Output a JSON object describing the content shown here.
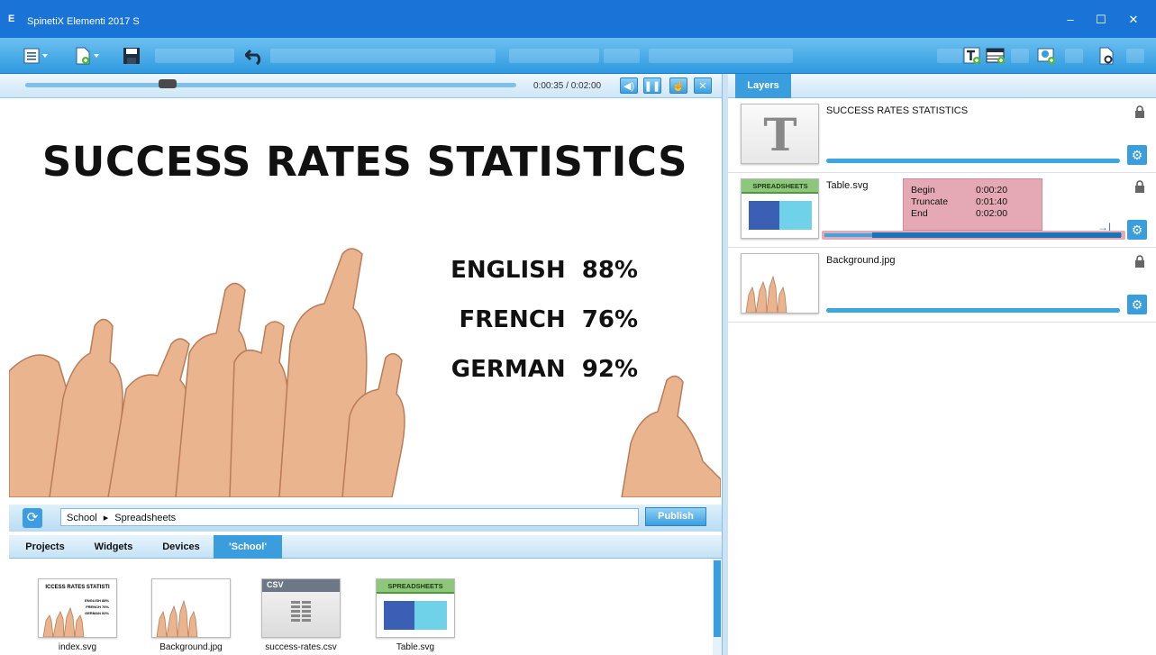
{
  "window": {
    "app_icon": "E",
    "title": "SpinetiX Elementi 2017 S",
    "minimize": "–",
    "maximize": "☐",
    "close": "✕"
  },
  "player": {
    "timecode": "0:00:35 / 0:02:00",
    "progress": 0.29
  },
  "preview": {
    "title": "SUCCESS RATES STATISTICS",
    "stats": [
      {
        "label": "ENGLISH  88%"
      },
      {
        "label": "FRENCH  76%"
      },
      {
        "label": "GERMAN  92%"
      }
    ]
  },
  "path": {
    "crumb1": "School",
    "sep": "▸",
    "crumb2": "Spreadsheets",
    "publish_label": "Publish"
  },
  "tabs": [
    {
      "label": "Projects"
    },
    {
      "label": "Widgets"
    },
    {
      "label": "Devices"
    },
    {
      "label": "'School'"
    }
  ],
  "files": [
    {
      "name": "index.svg",
      "thumb_text": "ICCESS RATES STATISTI",
      "stats_lines": [
        "ENGLISH 88%",
        "FRENCH 76%",
        "GERMAN 92%"
      ]
    },
    {
      "name": "Background.jpg"
    },
    {
      "name": "success-rates.csv",
      "badge": "CSV"
    },
    {
      "name": "Table.svg",
      "badge": "SPREADSHEETS"
    }
  ],
  "layers": {
    "tab_label": "Layers",
    "items": [
      {
        "name": "SUCCESS RATES STATISTICS",
        "thumb_letter": "T"
      },
      {
        "name": "Table.svg",
        "badge": "SPREADSHEETS"
      },
      {
        "name": "Background.jpg"
      }
    ],
    "timing": {
      "begin_label": "Begin",
      "begin_value": "0:00:20",
      "truncate_label": "Truncate",
      "truncate_value": "0:01:40",
      "end_label": "End",
      "end_value": "0:02:00"
    }
  }
}
